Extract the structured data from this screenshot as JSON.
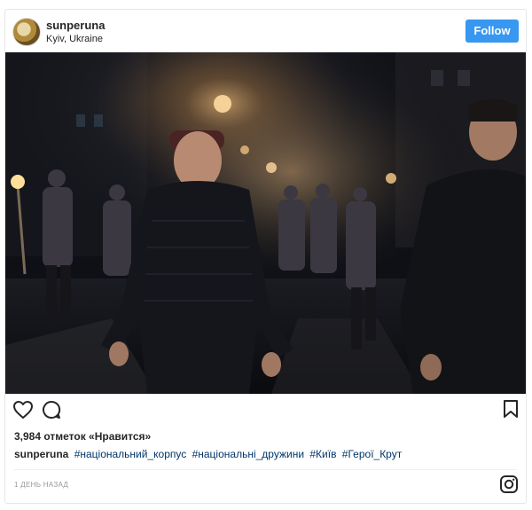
{
  "header": {
    "username": "sunperuna",
    "location": "Kyiv, Ukraine",
    "follow_label": "Follow"
  },
  "photo": {
    "description_icon": "photo-night-march"
  },
  "actions": {
    "like_icon": "heart-outline-icon",
    "comment_icon": "comment-icon",
    "save_icon": "bookmark-icon"
  },
  "likes_text": "3,984 отметок «Нравится»",
  "caption": {
    "username": "sunperuna",
    "tags": [
      "#національний_корпус",
      "#національні_дружини",
      "#Київ",
      "#Герої_Крут"
    ]
  },
  "timestamp": "1 день назад",
  "colors": {
    "accent": "#3897f0",
    "hashtag": "#003569",
    "text": "#262626",
    "muted": "#999999"
  }
}
